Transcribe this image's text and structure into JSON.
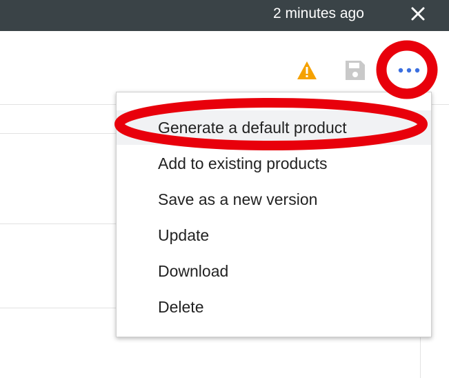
{
  "notification": {
    "time_text": "2 minutes ago",
    "close_icon": "close-icon"
  },
  "toolbar": {
    "warning_icon": "warning-icon",
    "save_icon": "save-icon",
    "more_icon": "more-options-icon"
  },
  "menu": {
    "items": [
      {
        "label": "Generate a default product"
      },
      {
        "label": "Add to existing products"
      },
      {
        "label": "Save as a new version"
      },
      {
        "label": "Update"
      },
      {
        "label": "Download"
      },
      {
        "label": "Delete"
      }
    ]
  },
  "colors": {
    "top_bar": "#3a4347",
    "warning": "#f5a100",
    "accent": "#3b6fe0",
    "annotation": "#e8000b"
  }
}
